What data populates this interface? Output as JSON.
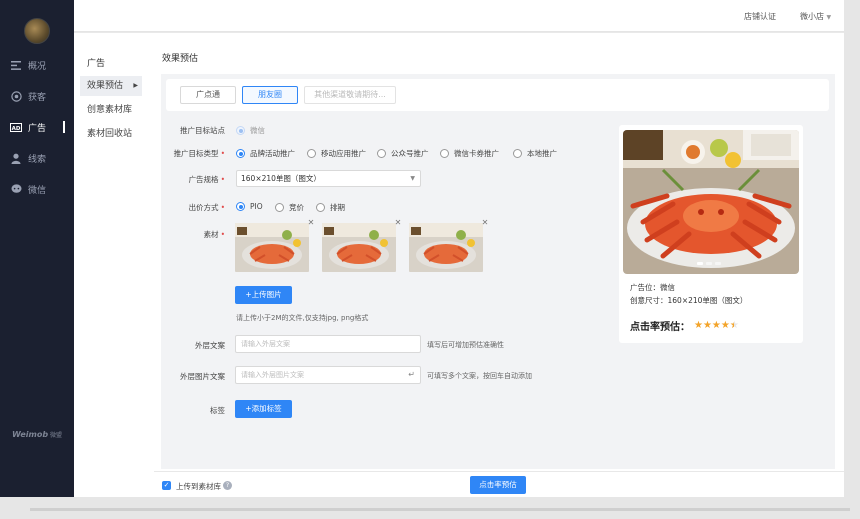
{
  "sidebar": {
    "items": [
      {
        "label": "概况",
        "icon": "menu-lines-icon"
      },
      {
        "label": "获客",
        "icon": "target-icon"
      },
      {
        "label": "广告",
        "icon": "ad-icon"
      },
      {
        "label": "线索",
        "icon": "person-icon"
      },
      {
        "label": "微信",
        "icon": "chat-bubble-icon"
      }
    ],
    "brand": "Weimob",
    "brand_cn": "微盟"
  },
  "topbar": {
    "store_cert": "店铺认证",
    "store_name": "微小店"
  },
  "subnav": {
    "title": "广告",
    "items": [
      "效果预估",
      "创意素材库",
      "素材回收站"
    ]
  },
  "content": {
    "heading": "效果预估",
    "tabs": [
      "广点通",
      "朋友圈",
      "其他渠道敬请期待..."
    ],
    "form": {
      "site_label": "推广目标站点",
      "site_value": "微信",
      "type_label": "推广目标类型",
      "type_options": [
        "品牌活动推广",
        "移动应用推广",
        "公众号推广",
        "微信卡券推广",
        "本地推广"
      ],
      "spec_label": "广告规格",
      "spec_value": "160×210单图（图文）",
      "bid_label": "出价方式",
      "bid_options": [
        "PIO",
        "竞价",
        "排期"
      ],
      "material_label": "素材",
      "upload_button": "+上传图片",
      "upload_hint": "请上传小于2M的文件,仅支持jpg, png格式",
      "outer_copy_label": "外层文案",
      "outer_copy_placeholder": "请输入外层文案",
      "outer_copy_hint": "填写后可增加预估准确性",
      "outer_img_copy_label": "外层图片文案",
      "outer_img_copy_placeholder": "请输入外层图片文案",
      "outer_img_copy_hint": "可填写多个文案，按回车自动添加",
      "tag_label": "标签",
      "tag_button": "+添加标签"
    },
    "preview": {
      "position": "广告位：微信",
      "size": "创意尺寸：160×210单图（图文）",
      "rate_label": "点击率预估：",
      "rate_stars": 4.5
    }
  },
  "footer": {
    "upload_to_library": "上传到素材库",
    "estimate_button": "点击率预估",
    "checked": true
  },
  "colors": {
    "accent": "#2f86f6",
    "sidebar_bg": "#1b2030",
    "star": "#f3a42a"
  }
}
